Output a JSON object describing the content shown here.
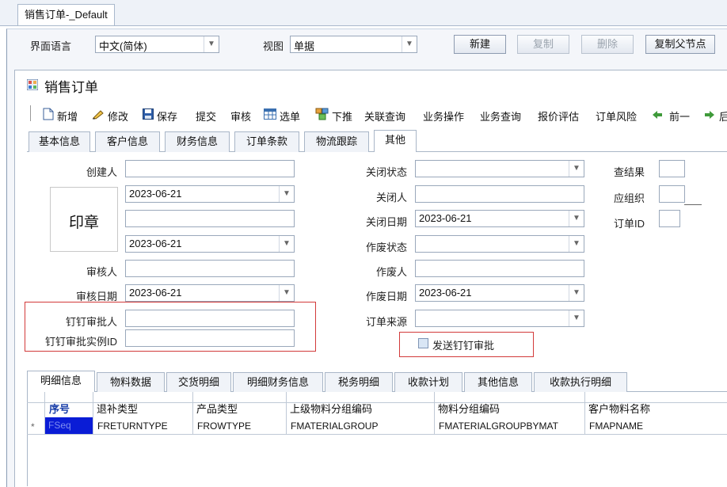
{
  "doc_tab": {
    "label": "销售订单-_Default"
  },
  "topbar": {
    "lang_label": "界面语言",
    "lang_value": "中文(简体)",
    "view_label": "视图",
    "view_value": "单据",
    "buttons": {
      "new": "新建",
      "copy": "复制",
      "delete": "删除",
      "copy_parent": "复制父节点"
    }
  },
  "form_title": "销售订单",
  "toolbar": {
    "new": "新增",
    "edit": "修改",
    "save": "保存",
    "submit": "提交",
    "audit": "审核",
    "select": "选单",
    "push": "下推",
    "related": "关联查询",
    "biz_op": "业务操作",
    "biz_query": "业务查询",
    "quote_eval": "报价评估",
    "order_risk": "订单风险",
    "prev": "前一",
    "next": "后"
  },
  "tabs": [
    "基本信息",
    "客户信息",
    "财务信息",
    "订单条款",
    "物流跟踪",
    "其他"
  ],
  "left_fields": {
    "creator_label": "创建人",
    "creator_value": "",
    "date1_value": "2023-06-21",
    "field3_value": "",
    "date2_value": "2023-06-21",
    "auditor_label": "审核人",
    "auditor_value": "",
    "audit_date_label": "审核日期",
    "audit_date_value": "2023-06-21",
    "dingtalk_approver_label": "钉钉审批人",
    "dingtalk_approver_value": "",
    "dingtalk_instance_label": "钉钉审批实例ID",
    "dingtalk_instance_value": ""
  },
  "stamp_label": "印章",
  "middle_fields": {
    "close_status_label": "关闭状态",
    "close_status_value": "",
    "closer_label": "关闭人",
    "closer_value": "",
    "close_date_label": "关闭日期",
    "close_date_value": "2023-06-21",
    "void_status_label": "作废状态",
    "void_status_value": "",
    "voider_label": "作废人",
    "voider_value": "",
    "void_date_label": "作废日期",
    "void_date_value": "2023-06-21",
    "order_source_label": "订单来源",
    "order_source_value": "",
    "send_dingtalk_label": "发送钉钉审批",
    "send_dingtalk_checked": false
  },
  "right_fields": {
    "check_result_label": "查结果",
    "resp_org_label": "应组织",
    "order_id_label": "订单ID"
  },
  "grid_tabs": [
    "明细信息",
    "物料数据",
    "交货明细",
    "明细财务信息",
    "税务明细",
    "收款计划",
    "其他信息",
    "收款执行明细"
  ],
  "grid": {
    "columns": [
      "序号",
      "退补类型",
      "产品类型",
      "上级物料分组编码",
      "物料分组编码",
      "客户物料名称"
    ],
    "row": [
      "FSeq",
      "FRETURNTYPE",
      "FROWTYPE",
      "FMATERIALGROUP",
      "FMATERIALGROUPBYMAT",
      "FMAPNAME"
    ],
    "row_marker": "*"
  }
}
